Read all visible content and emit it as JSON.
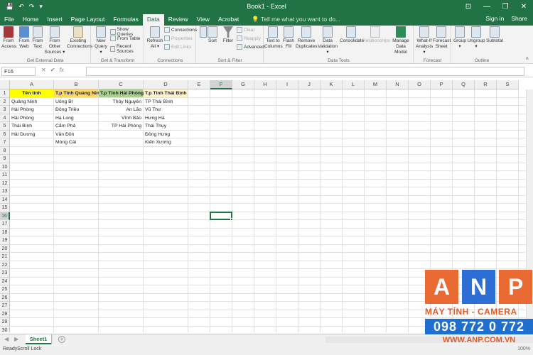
{
  "titlebar": {
    "title": "Book1 - Excel",
    "qat_save": "💾",
    "qat_undo": "↶",
    "qat_redo": "↷",
    "qat_more": "▾"
  },
  "tabs": [
    "File",
    "Home",
    "Insert",
    "Page Layout",
    "Formulas",
    "Data",
    "Review",
    "View",
    "Acrobat"
  ],
  "active_tab": "Data",
  "tellme": "💡 Tell me what you want to do...",
  "signin": "Sign in",
  "share": "Share",
  "ribbon": {
    "get_external": {
      "label": "Get External Data",
      "from_access": "From\nAccess",
      "from_web": "From\nWeb",
      "from_text": "From\nText",
      "from_other": "From Other\nSources ▾",
      "existing": "Existing\nConnections"
    },
    "get_transform": {
      "label": "Get & Transform",
      "new_query": "New\nQuery ▾",
      "show_queries": "Show Queries",
      "from_table": "From Table",
      "recent_sources": "Recent Sources"
    },
    "connections": {
      "label": "Connections",
      "refresh": "Refresh\nAll ▾",
      "connections": "Connections",
      "properties": "Properties",
      "edit_links": "Edit Links"
    },
    "sort_filter": {
      "label": "Sort & Filter",
      "sort": "Sort",
      "filter": "Filter",
      "clear": "Clear",
      "reapply": "Reapply",
      "advanced": "Advanced"
    },
    "data_tools": {
      "label": "Data Tools",
      "text_to_columns": "Text to\nColumns",
      "flash_fill": "Flash\nFill",
      "remove_dup": "Remove\nDuplicates",
      "validation": "Data\nValidation ▾",
      "consolidate": "Consolidate",
      "relationships": "Relationships",
      "data_model": "Manage\nData Model"
    },
    "forecast": {
      "label": "Forecast",
      "what_if": "What-If\nAnalysis ▾",
      "forecast_sheet": "Forecast\nSheet"
    },
    "outline": {
      "label": "Outline",
      "group": "Group\n▾",
      "ungroup": "Ungroup\n▾",
      "subtotal": "Subtotal"
    }
  },
  "formula_bar": {
    "name_box": "F16",
    "cancel": "✕",
    "enter": "✔",
    "fx": "fx",
    "value": ""
  },
  "columns": [
    "A",
    "B",
    "C",
    "D",
    "E",
    "F",
    "G",
    "H",
    "I",
    "J",
    "K",
    "L",
    "M",
    "N",
    "O",
    "P",
    "Q",
    "R",
    "S"
  ],
  "selected_cell": "F16",
  "rows": [
    "1",
    "2",
    "3",
    "4",
    "5",
    "6",
    "7",
    "8",
    "9",
    "10",
    "11",
    "12",
    "13",
    "14",
    "15",
    "16",
    "17",
    "18",
    "19",
    "20",
    "21",
    "22",
    "23",
    "24",
    "25",
    "26",
    "27",
    "28",
    "29",
    "30"
  ],
  "table": {
    "headers": [
      "Tên tỉnh",
      "T.p Tỉnh Quảng Ninh",
      "T.p Tỉnh Hải Phòng",
      "T.p Tỉnh Thái Bình"
    ],
    "header_colors": [
      "#ffff00",
      "#ffd966",
      "#a9d08e",
      "#fff2cc"
    ],
    "col_a": [
      "Quảng Ninh",
      "Hải Phòng",
      "Hải Phòng",
      "Thái Bình",
      "Hải Dương"
    ],
    "col_b": [
      "Uông Bí",
      "Đông Triều",
      "Hạ Long",
      "Cẩm Phả",
      "Vân Đồn",
      "Móng Cái"
    ],
    "col_c": [
      "Thủy Nguyên",
      "An Lão",
      "Vĩnh Bảo",
      "TP Hải Phòng"
    ],
    "col_d": [
      "TP Thái Bình",
      "Vũ Thư",
      "Hưng Hà",
      "Thái Thụy",
      "Đông Hưng",
      "Kiến Xương"
    ]
  },
  "sheets": [
    "Sheet1"
  ],
  "add_sheet": "+",
  "status": {
    "ready": "Ready",
    "scroll_lock": "Scroll Lock",
    "zoom": "100%"
  },
  "watermark": {
    "letters": [
      "A",
      "N",
      "P"
    ],
    "tagline": "MÁY TÍNH - CAMERA",
    "phone": "098 772 0 772",
    "site": "WWW.ANP.COM.VN"
  }
}
